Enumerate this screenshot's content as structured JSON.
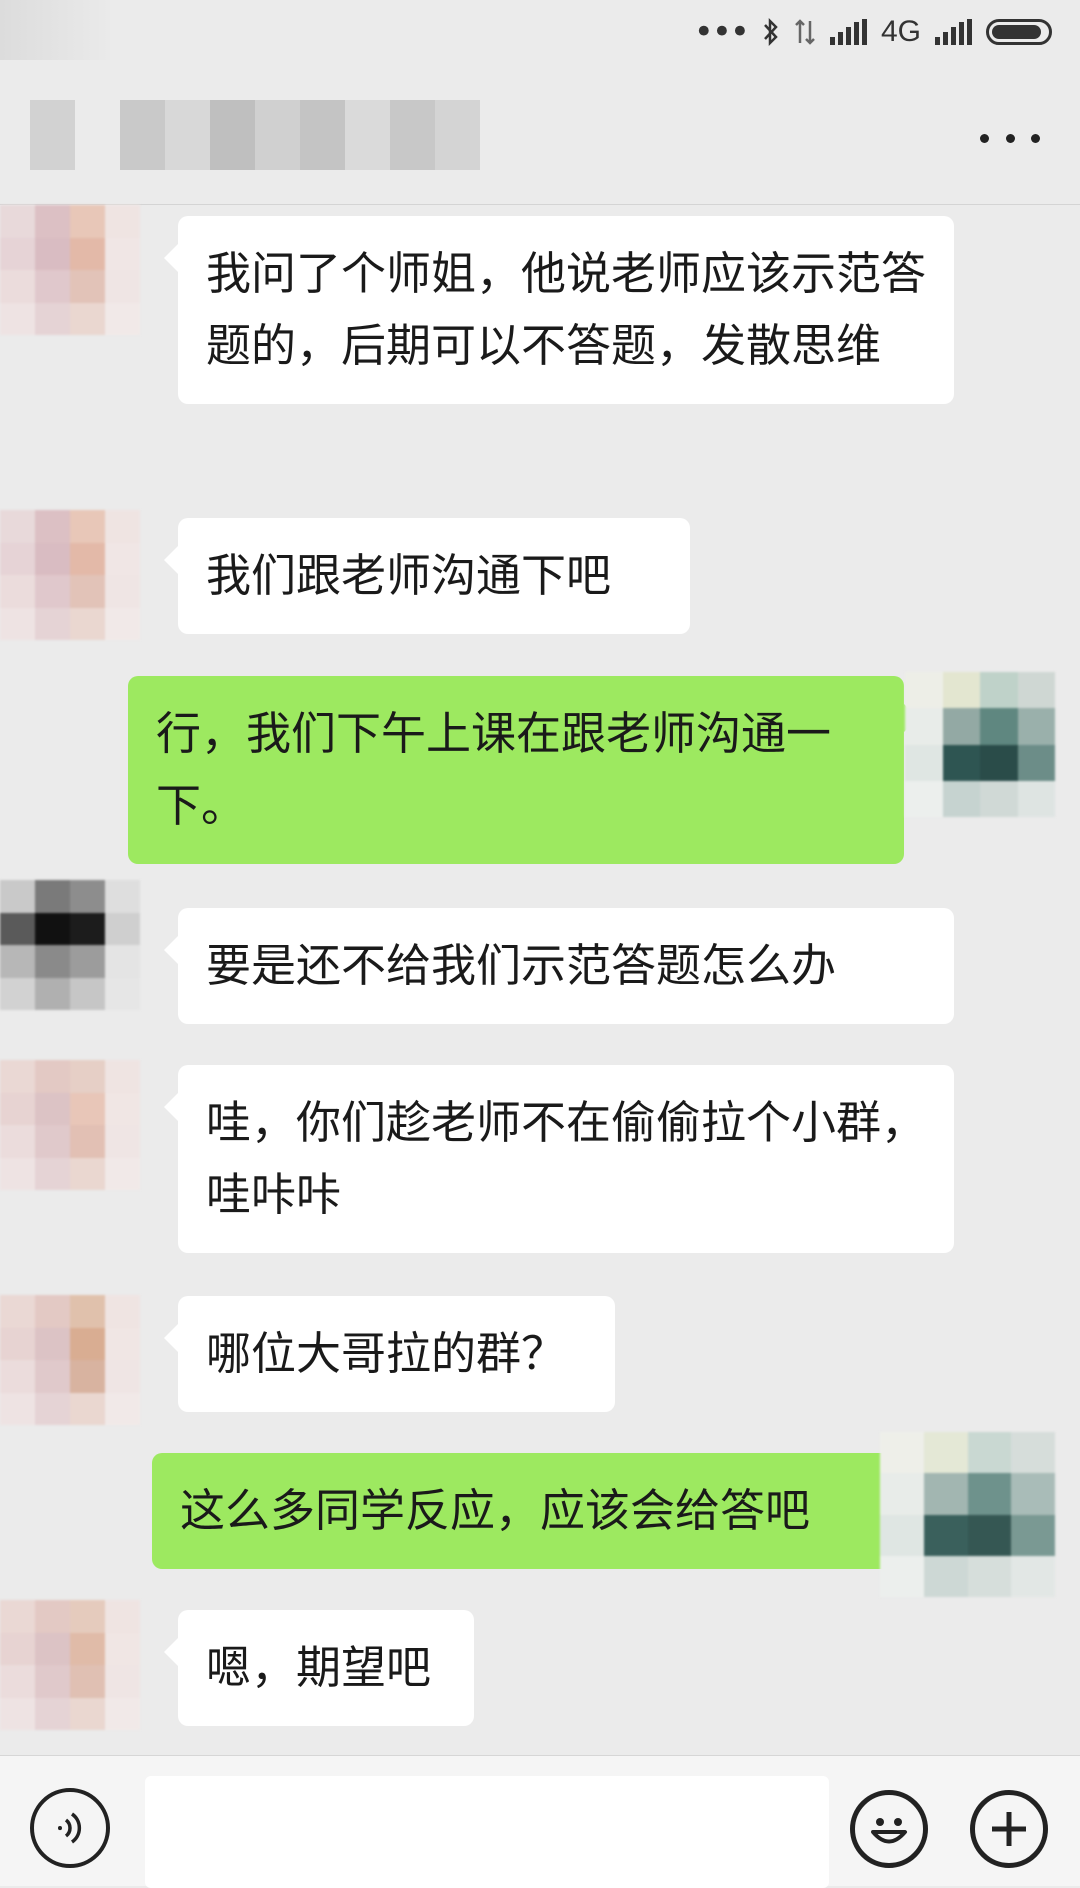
{
  "status_bar": {
    "network": "4G"
  },
  "header": {
    "title": "",
    "more_icon": "more-icon"
  },
  "messages": [
    {
      "side": "left",
      "text": "我问了个师姐，他说老师应该示范答题的，后期可以不答题，发散思维"
    },
    {
      "side": "left",
      "text": "我们跟老师沟通下吧"
    },
    {
      "side": "right",
      "text": "行，我们下午上课在跟老师沟通一下。"
    },
    {
      "side": "left",
      "text": "要是还不给我们示范答题怎么办"
    },
    {
      "side": "left",
      "text": "哇，你们趁老师不在偷偷拉个小群，哇咔咔"
    },
    {
      "side": "left",
      "text": "哪位大哥拉的群？"
    },
    {
      "side": "right",
      "text": "这么多同学反应，应该会给答吧"
    },
    {
      "side": "left",
      "text": "嗯，期望吧"
    }
  ],
  "input_bar": {
    "value": "",
    "voice_icon": "voice-icon",
    "emoji_icon": "emoji-icon",
    "add_icon": "plus-icon"
  },
  "colors": {
    "background": "#ebebeb",
    "bubble_left": "#ffffff",
    "bubble_right": "#9de960"
  }
}
